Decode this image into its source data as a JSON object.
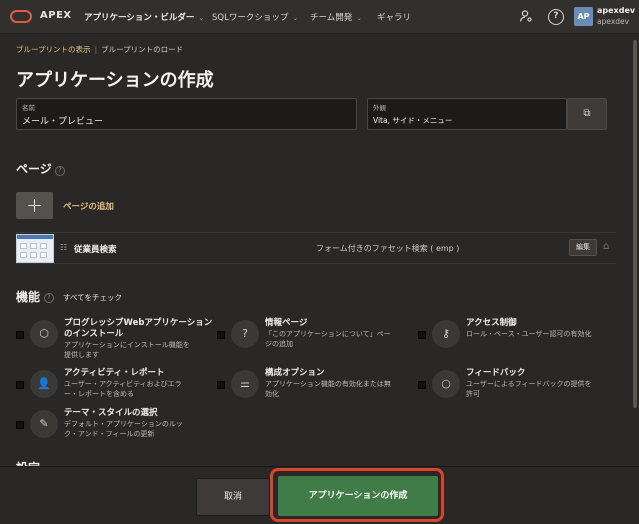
{
  "topbar": {
    "brand": "APEX",
    "nav": [
      {
        "label": "アプリケーション・ビルダー",
        "active": true
      },
      {
        "label": "SQLワークショップ",
        "active": false
      },
      {
        "label": "チーム開発",
        "active": false
      },
      {
        "label": "ギャラリ",
        "active": false
      }
    ],
    "avatar_initials": "AP",
    "user_name": "apexdev",
    "user_workspace": "apexdev"
  },
  "breadcrumb": {
    "link": "ブループリントの表示",
    "current": "ブループリントのロード"
  },
  "page_title": "アプリケーションの作成",
  "name_field": {
    "label": "名前",
    "value": "メール・プレビュー"
  },
  "appearance_field": {
    "label": "外観",
    "value": "Vita, サイド・メニュー"
  },
  "pages_section": {
    "title": "ページ",
    "add_label": "ページの追加",
    "rows": [
      {
        "name": "従業員検索",
        "description": "フォーム付きのファセット検索 ( emp )",
        "edit_label": "編集"
      }
    ]
  },
  "features_section": {
    "title": "機能",
    "check_all_label": "すべてをチェック",
    "items": [
      {
        "title_lines": [
          "プログレッシブWebアプリケーション",
          "のインストール"
        ],
        "desc_lines": [
          "アプリケーションにインストール機能を",
          "提供します"
        ],
        "icon": "box-icon"
      },
      {
        "title_lines": [
          "情報ページ"
        ],
        "desc_lines": [
          "「このアプリケーションについて」ペー",
          "ジの追加"
        ],
        "icon": "question-icon"
      },
      {
        "title_lines": [
          "アクセス制御"
        ],
        "desc_lines": [
          "ロール・ベース・ユーザー認可の有効化"
        ],
        "icon": "key-icon"
      },
      {
        "title_lines": [
          "アクティビティ・レポート"
        ],
        "desc_lines": [
          "ユーザー・アクティビティおよびエラ",
          "ー・レポートを含める"
        ],
        "icon": "user-report-icon"
      },
      {
        "title_lines": [
          "構成オプション"
        ],
        "desc_lines": [
          "アプリケーション機能の有効化または無",
          "効化"
        ],
        "icon": "sliders-icon"
      },
      {
        "title_lines": [
          "フィードバック"
        ],
        "desc_lines": [
          "ユーザーによるフィードバックの提供を",
          "許可"
        ],
        "icon": "comment-icon"
      },
      {
        "title_lines": [
          "テーマ・スタイルの選択"
        ],
        "desc_lines": [
          "デフォルト・アプリケーションのルッ",
          "ク・アンド・フィールの更新"
        ],
        "icon": "brush-icon"
      }
    ]
  },
  "settings_peek": "設定",
  "footer": {
    "cancel_label": "取消",
    "create_label": "アプリケーションの作成"
  },
  "colors": {
    "accent": "#e5c07b",
    "create_button": "#3f7c47",
    "highlight": "#d9442b",
    "logo": "#e05a45"
  }
}
